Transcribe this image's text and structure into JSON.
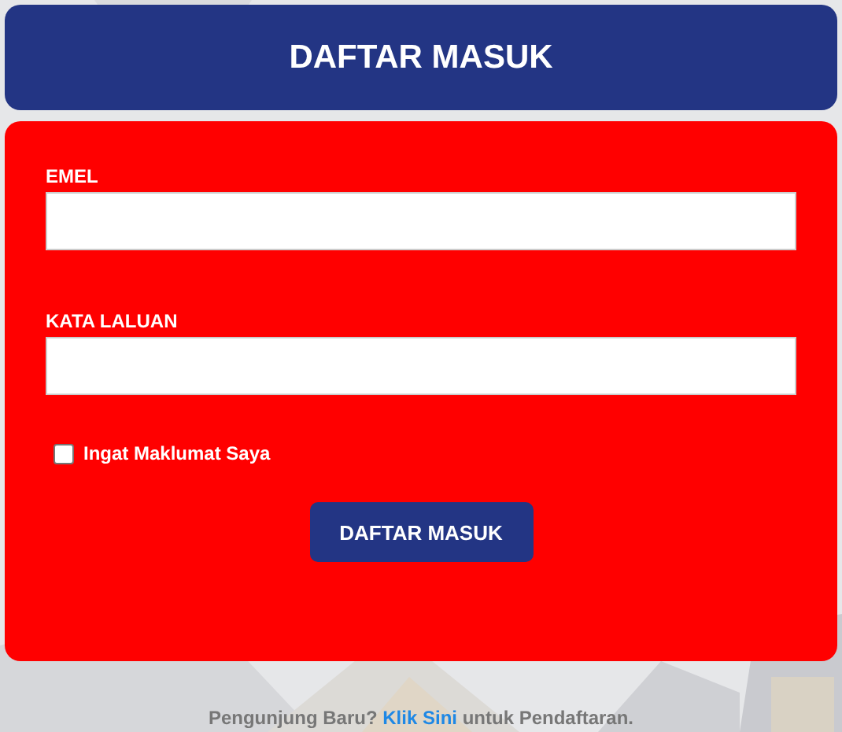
{
  "header": {
    "title": "DAFTAR MASUK"
  },
  "form": {
    "fields": [
      {
        "label": "EMEL"
      },
      {
        "label": "KATA LALUAN"
      }
    ],
    "remember": {
      "label": "Ingat Maklumat Saya",
      "checked": false
    },
    "submit": "DAFTAR MASUK"
  },
  "footer": {
    "before": "Pengunjung Baru?",
    "link": "Klik Sini",
    "after": "untuk Pendaftaran."
  }
}
